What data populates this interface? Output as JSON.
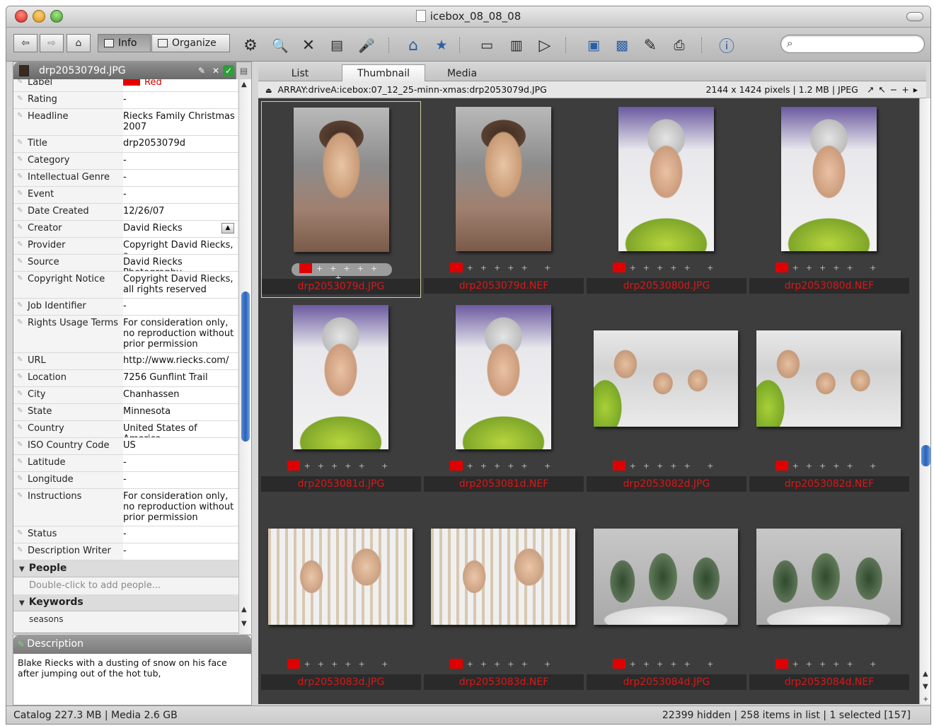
{
  "window": {
    "title": "icebox_08_08_08"
  },
  "toolbar": {
    "info_label": "Info",
    "organize_label": "Organize",
    "search_value": "",
    "search_placeholder": ""
  },
  "info_panel": {
    "header_filename": "drp2053079d.JPG",
    "fields": [
      {
        "label": "Label",
        "value": "Red"
      },
      {
        "label": "Rating",
        "value": "-"
      },
      {
        "label": "Headline",
        "value": "Riecks Family Christmas\n2007"
      },
      {
        "label": "Title",
        "value": "drp2053079d"
      },
      {
        "label": "Category",
        "value": "-"
      },
      {
        "label": "Intellectual Genre",
        "value": "-"
      },
      {
        "label": "Event",
        "value": "-"
      },
      {
        "label": "Date Created",
        "value": "12/26/07"
      },
      {
        "label": "Creator",
        "value": "David Riecks"
      },
      {
        "label": "Provider",
        "value": "Copyright David Riecks, a"
      },
      {
        "label": "Source",
        "value": "David Riecks Photography"
      },
      {
        "label": "Copyright Notice",
        "value": "Copyright David Riecks,\nall rights reserved"
      },
      {
        "label": "Job Identifier",
        "value": "-"
      },
      {
        "label": "Rights Usage Terms",
        "value": "For consideration only,\nno reproduction without\nprior permission"
      },
      {
        "label": "URL",
        "value": "http://www.riecks.com/"
      },
      {
        "label": "Location",
        "value": "7256 Gunflint Trail"
      },
      {
        "label": "City",
        "value": "Chanhassen"
      },
      {
        "label": "State",
        "value": "Minnesota"
      },
      {
        "label": "Country",
        "value": "United States of America"
      },
      {
        "label": "ISO Country Code",
        "value": "US"
      },
      {
        "label": "Latitude",
        "value": "-"
      },
      {
        "label": "Longitude",
        "value": "-"
      },
      {
        "label": "Instructions",
        "value": "For consideration only,\nno reproduction without\nprior permission"
      },
      {
        "label": "Status",
        "value": "-"
      },
      {
        "label": "Description Writer",
        "value": "-"
      }
    ],
    "people_section": "People",
    "people_hint": "Double-click to add people...",
    "keywords_section": "Keywords",
    "keyword_partial": "seasons"
  },
  "description": {
    "header": "Description",
    "text": "Blake Riecks with a dusting of snow on his face after jumping out of the hot tub,"
  },
  "tabs": [
    "List",
    "Thumbnail",
    "Media"
  ],
  "active_tab": "Thumbnail",
  "pathbar": {
    "path": "ARRAY:driveA:icebox:07_12_25-minn-xmas:drp2053079d.JPG",
    "info": "2144 x 1424 pixels  |  1.2 MB  |  JPEG"
  },
  "thumbnails": [
    {
      "name": "drp2053079d.JPG",
      "scene": "boy",
      "orientation": "portrait",
      "selected": true
    },
    {
      "name": "drp2053079d.NEF",
      "scene": "boy",
      "orientation": "portrait"
    },
    {
      "name": "drp2053080d.JPG",
      "scene": "man",
      "orientation": "portrait"
    },
    {
      "name": "drp2053080d.NEF",
      "scene": "man",
      "orientation": "portrait"
    },
    {
      "name": "drp2053081d.JPG",
      "scene": "man",
      "orientation": "portrait"
    },
    {
      "name": "drp2053081d.NEF",
      "scene": "man",
      "orientation": "portrait"
    },
    {
      "name": "drp2053082d.JPG",
      "scene": "trio",
      "orientation": "landscape"
    },
    {
      "name": "drp2053082d.NEF",
      "scene": "trio",
      "orientation": "landscape"
    },
    {
      "name": "drp2053083d.JPG",
      "scene": "duo",
      "orientation": "landscape"
    },
    {
      "name": "drp2053083d.NEF",
      "scene": "duo",
      "orientation": "landscape"
    },
    {
      "name": "drp2053084d.JPG",
      "scene": "tree",
      "orientation": "landscape"
    },
    {
      "name": "drp2053084d.NEF",
      "scene": "tree",
      "orientation": "landscape"
    }
  ],
  "statusbar": {
    "left": "Catalog  227.3 MB  |  Media 2.6 GB",
    "right": "22399 hidden  |  258 items in list  |  1 selected [157]"
  },
  "colors": {
    "label_red": "#e00000",
    "filename_red": "#d91818",
    "grid_bg": "#3d3d3d"
  }
}
